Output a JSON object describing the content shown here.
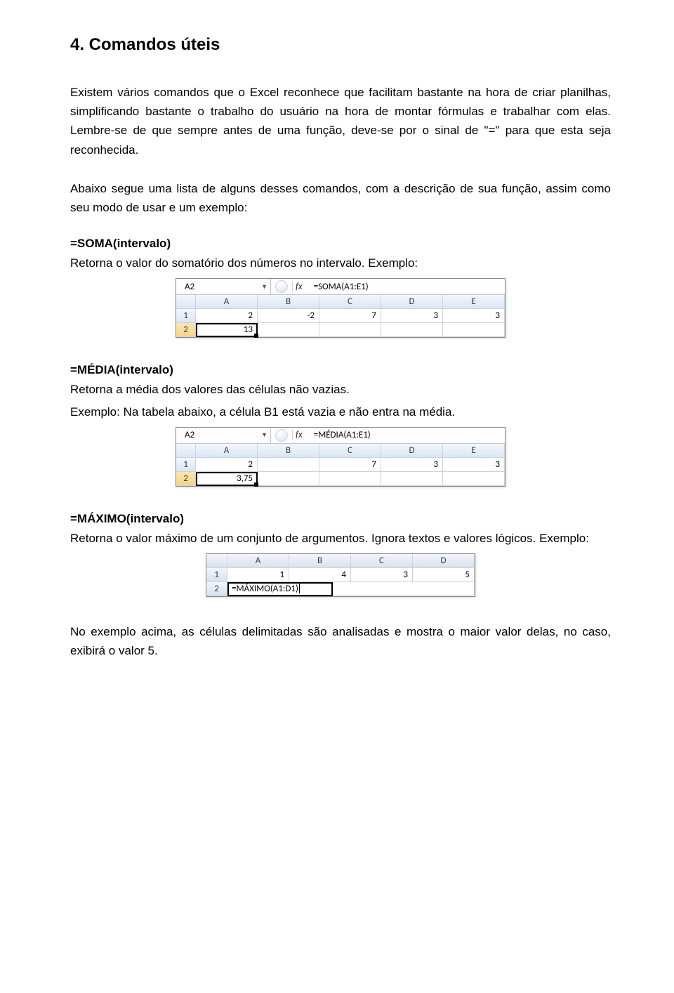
{
  "title": "4. Comandos úteis",
  "intro_p1": "Existem vários comandos que o Excel reconhece que facilitam bastante na hora de criar planilhas, simplificando bastante o trabalho do usuário na hora de montar fórmulas e trabalhar com elas. Lembre-se de que sempre antes de uma função, deve-se por o sinal de \"=\" para que esta seja reconhecida.",
  "intro_p2": "Abaixo segue uma lista de alguns desses comandos, com a descrição de sua função, assim como seu modo de usar e um exemplo:",
  "soma": {
    "head": "=SOMA(intervalo)",
    "desc": "Retorna o valor do somatório dos números no intervalo. Exemplo:",
    "namebox": "A2",
    "formula": "=SOMA(A1:E1)",
    "fx_label": "fx",
    "cols": [
      "A",
      "B",
      "C",
      "D",
      "E"
    ],
    "rows": [
      "1",
      "2"
    ],
    "cells": {
      "r1": [
        "2",
        "-2",
        "7",
        "3",
        "3"
      ],
      "r2": [
        "13",
        "",
        "",
        "",
        ""
      ]
    }
  },
  "media": {
    "head": "=MÉDIA(intervalo)",
    "desc1": "Retorna a média dos valores das células não vazias.",
    "desc2": "Exemplo: Na tabela abaixo, a célula B1 está vazia e não entra na média.",
    "namebox": "A2",
    "formula": "=MÉDIA(A1:E1)",
    "fx_label": "fx",
    "cols": [
      "A",
      "B",
      "C",
      "D",
      "E"
    ],
    "rows": [
      "1",
      "2"
    ],
    "cells": {
      "r1": [
        "2",
        "",
        "7",
        "3",
        "3"
      ],
      "r2": [
        "3,75",
        "",
        "",
        "",
        ""
      ]
    }
  },
  "maximo": {
    "head": "=MÁXIMO(intervalo)",
    "desc": "Retorna o valor máximo de um conjunto de argumentos. Ignora textos e valores lógicos. Exemplo:",
    "cols": [
      "A",
      "B",
      "C",
      "D"
    ],
    "rows": [
      "1",
      "2"
    ],
    "cells": {
      "r1": [
        "1",
        "4",
        "3",
        "5"
      ],
      "r2_formula": "=MÁXIMO(A1:D1)"
    },
    "closing": "No exemplo acima, as células delimitadas são analisadas e mostra o maior valor delas, no caso, exibirá o valor 5."
  }
}
